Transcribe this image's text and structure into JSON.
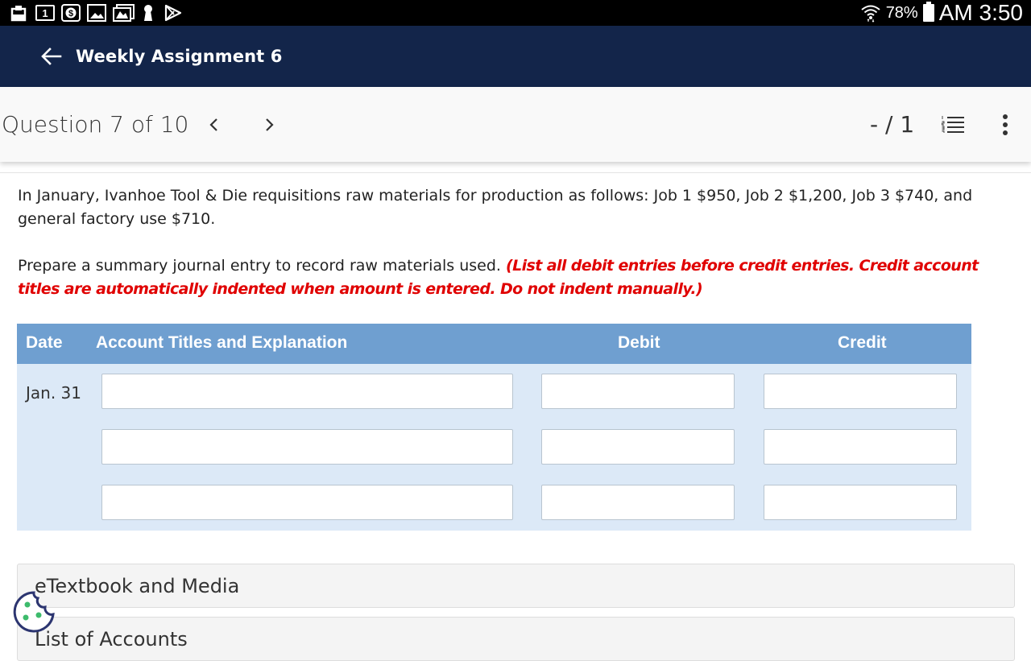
{
  "status_bar": {
    "calendar_day": "1",
    "battery_percent": "78%",
    "time": "AM 3:50",
    "icons": [
      "clipboard-icon",
      "calendar-icon",
      "money-icon",
      "image-icon",
      "gallery-icon",
      "keyhole-icon",
      "play-store-icon",
      "wifi-icon",
      "battery-icon"
    ]
  },
  "app_bar": {
    "title": "Weekly Assignment 6"
  },
  "question_nav": {
    "title": "Question 7 of 10",
    "score": "- / 1"
  },
  "question": {
    "text": "In January, Ivanhoe Tool & Die requisitions raw materials for production as follows: Job 1 $950, Job 2 $1,200, Job 3 $740, and general factory use $710.",
    "prompt": "Prepare a summary journal entry to record raw materials used. ",
    "instruction": "(List all debit entries before credit entries. Credit account titles are automatically indented when amount is entered. Do not indent manually.)"
  },
  "journal": {
    "headers": {
      "date": "Date",
      "account": "Account Titles and Explanation",
      "debit": "Debit",
      "credit": "Credit"
    },
    "date": "Jan. 31",
    "rows": [
      {
        "account": "",
        "debit": "",
        "credit": ""
      },
      {
        "account": "",
        "debit": "",
        "credit": ""
      },
      {
        "account": "",
        "debit": "",
        "credit": ""
      }
    ]
  },
  "sections": [
    {
      "label": "eTextbook and Media"
    },
    {
      "label": "List of Accounts"
    }
  ],
  "colors": {
    "app_bar": "#13254a",
    "table_header": "#6f9fd0",
    "table_body": "#dce9f7",
    "instruction": "#e00000"
  }
}
